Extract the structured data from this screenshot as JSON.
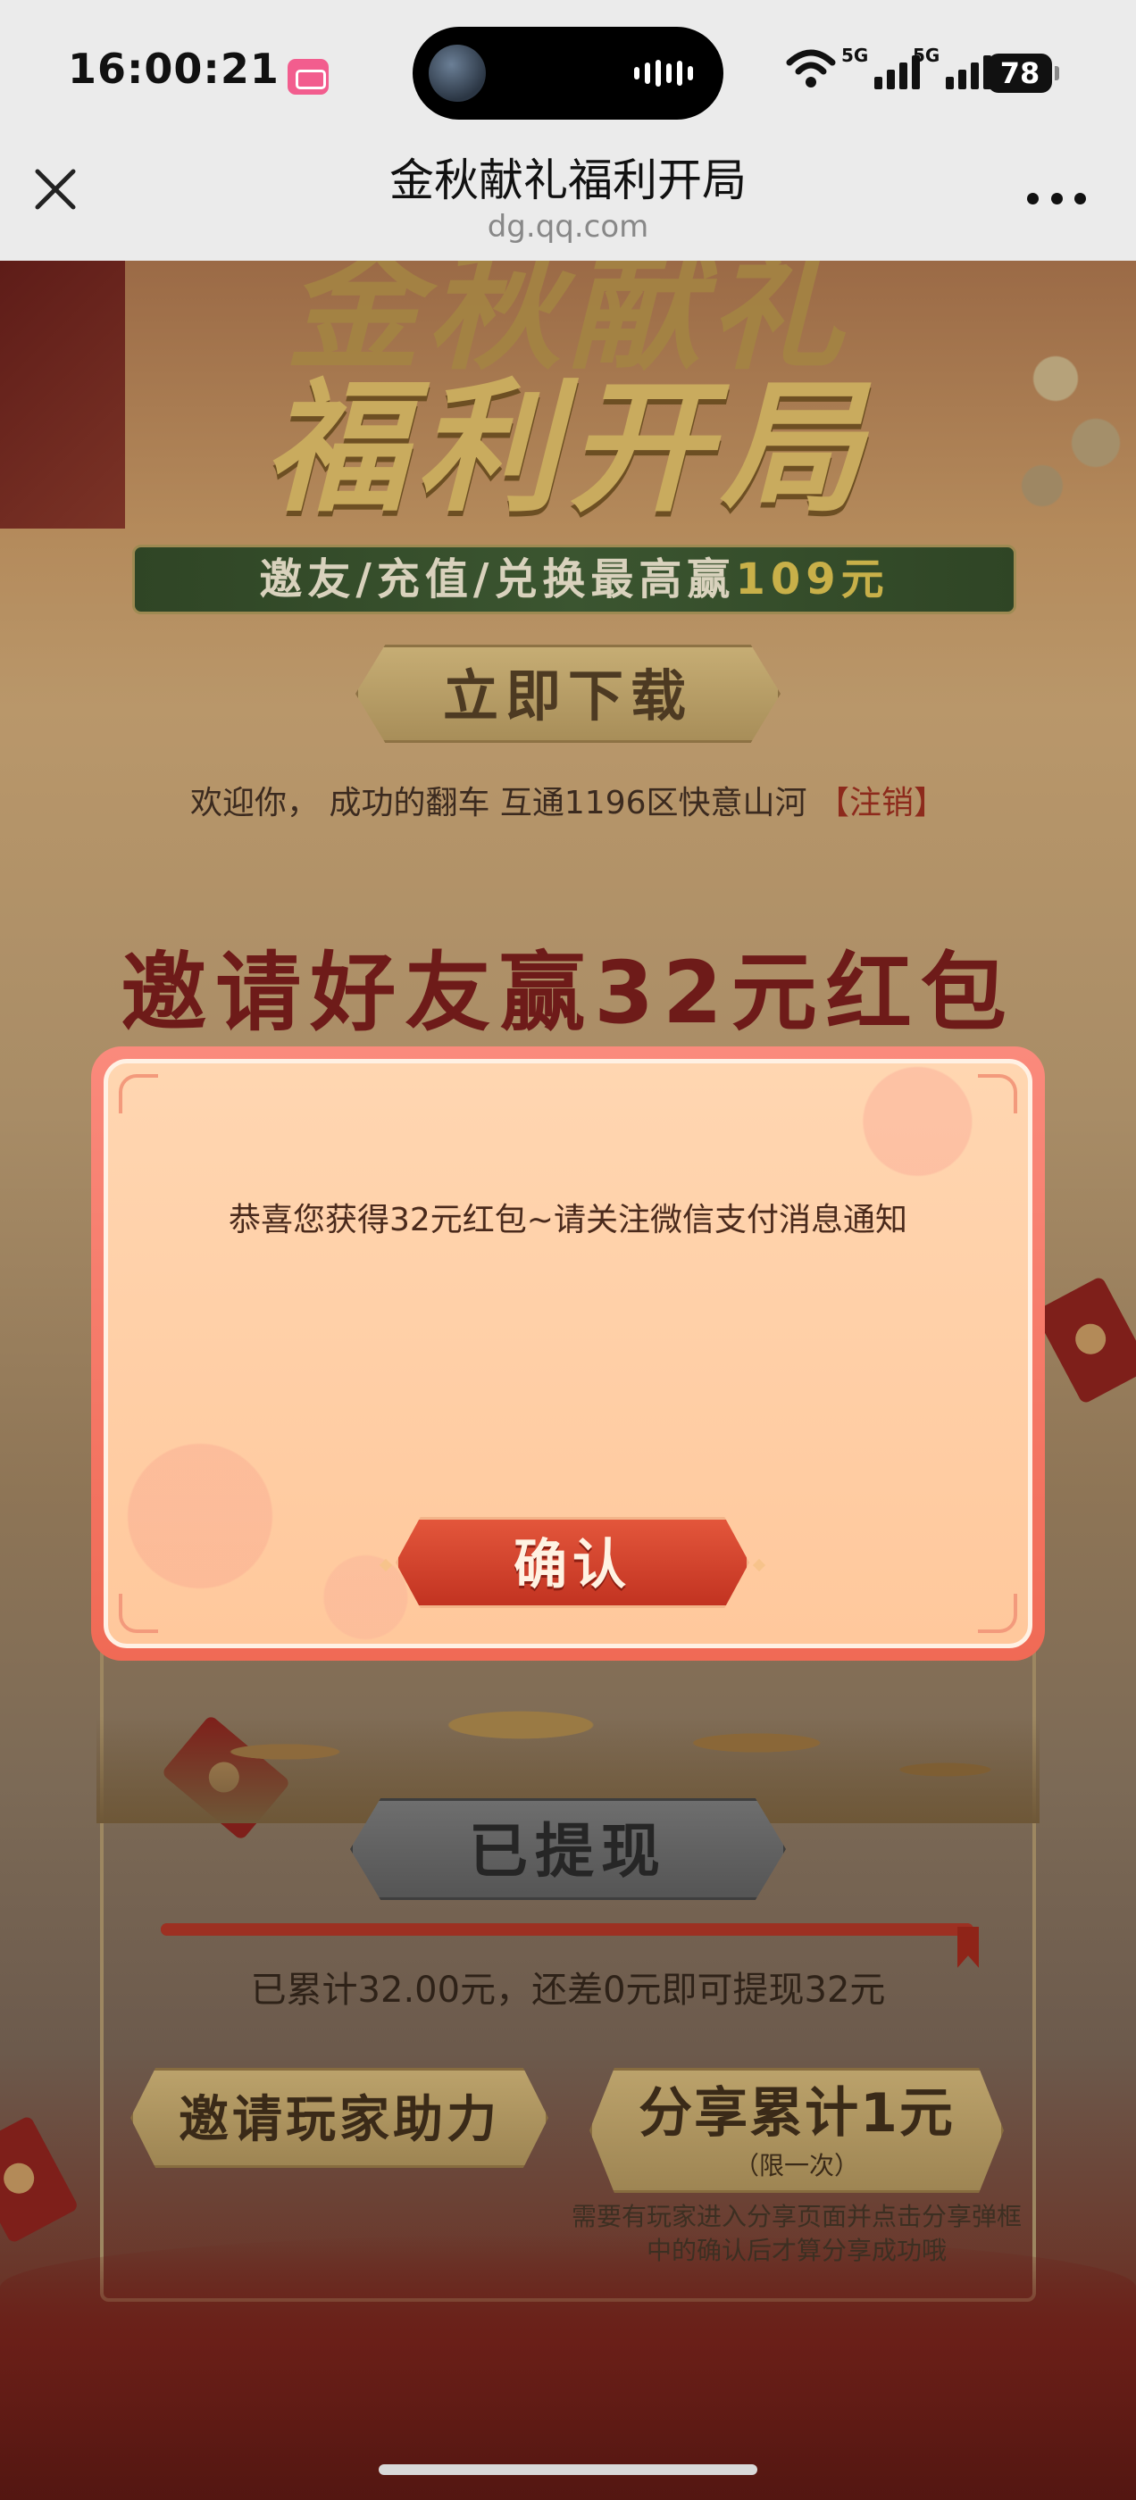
{
  "status_bar": {
    "time": "16:00:21",
    "network_1": "5G",
    "network_2": "5G",
    "battery": "78"
  },
  "nav": {
    "title": "金秋献礼福利开局",
    "url": "dg.qq.com"
  },
  "hero": {
    "title_line1": "金秋献礼",
    "title_line2": "福利开局",
    "banner_prefix": "邀友/充值/兑换最高赢",
    "banner_highlight": "109元"
  },
  "download_button": "立即下载",
  "welcome": {
    "text": "欢迎你， 成功的翻车 互通1196区快意山河",
    "logout": "【注销】"
  },
  "invite_title": "邀请好友赢32元红包",
  "withdraw": {
    "button": "已提现",
    "progress_fraction": 1.0,
    "accum_text": "已累计32.00元，还差0元即可提现32元"
  },
  "actions": {
    "help_button": "邀请玩家助力",
    "share_button": "分享累计1元",
    "share_sub": "（限一次）",
    "share_hint": "需要有玩家进入分享页面并点击分享弹框中的确认后才算分享成功哦"
  },
  "modal": {
    "message": "恭喜您获得32元红包~请关注微信支付消息通知",
    "confirm": "确认"
  },
  "colors": {
    "modal_border": "#f06a55",
    "modal_fill": "#ffd0a8",
    "confirm_red": "#d0402a",
    "logout_red": "#8d2a1c"
  }
}
